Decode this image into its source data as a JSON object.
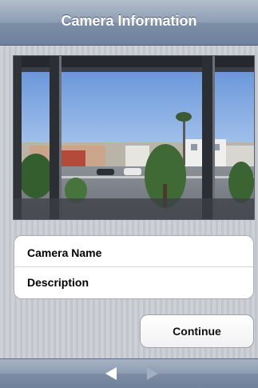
{
  "header": {
    "title": "Camera Information"
  },
  "preview": {
    "alt": "Camera live preview"
  },
  "form": {
    "fields": [
      {
        "label": "Camera Name"
      },
      {
        "label": "Description"
      }
    ]
  },
  "actions": {
    "continue_label": "Continue"
  },
  "toolbar": {
    "back_icon": "back-arrow-icon",
    "forward_icon": "forward-arrow-icon",
    "forward_enabled": false
  },
  "colors": {
    "navbar": "#8e9db3",
    "background": "#c8cbd1",
    "card": "#ffffff"
  }
}
